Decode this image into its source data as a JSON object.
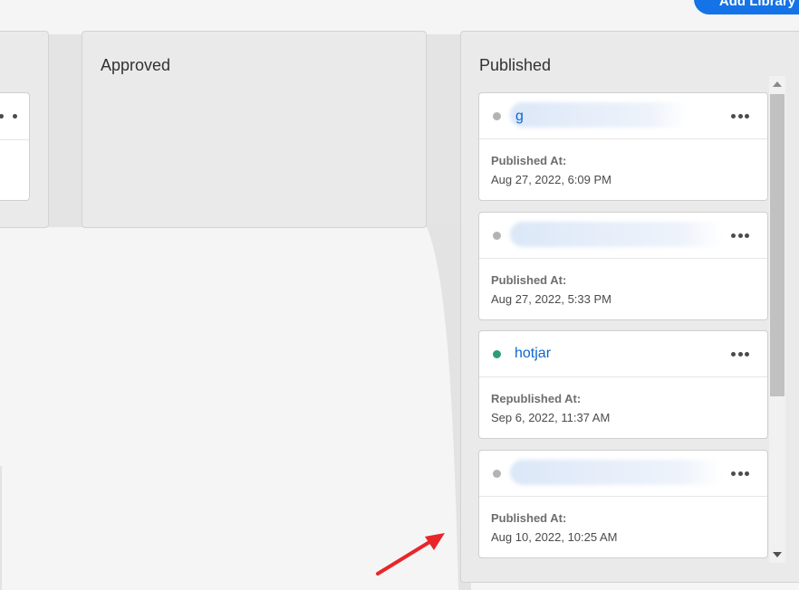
{
  "header": {
    "add_library_label": "Add Library"
  },
  "columns": {
    "approved": {
      "title": "Approved"
    },
    "published": {
      "title": "Published"
    }
  },
  "cards": [
    {
      "name_visible": "g",
      "status": "gray",
      "label": "Published At:",
      "date": "Aug 27, 2022, 6:09 PM"
    },
    {
      "name_visible": "",
      "status": "gray",
      "label": "Published At:",
      "date": "Aug 27, 2022, 5:33 PM"
    },
    {
      "name_visible": "hotjar",
      "status": "green",
      "label": "Republished At:",
      "date": "Sep 6, 2022, 11:37 AM"
    },
    {
      "name_visible": "",
      "status": "gray",
      "label": "Published At:",
      "date": "Aug 10, 2022, 10:25 AM"
    }
  ],
  "icons": {
    "more": "more-horizontal-icon",
    "status": "status-dot-icon",
    "scroll_up": "chevron-up-icon",
    "scroll_down": "chevron-down-icon",
    "annotation": "red-arrow-annotation"
  },
  "colors": {
    "accent": "#1473e6",
    "link": "#0d66d0",
    "status_gray": "#b3b3b3",
    "status_green": "#2d9d78",
    "annotation": "#e8262a"
  }
}
